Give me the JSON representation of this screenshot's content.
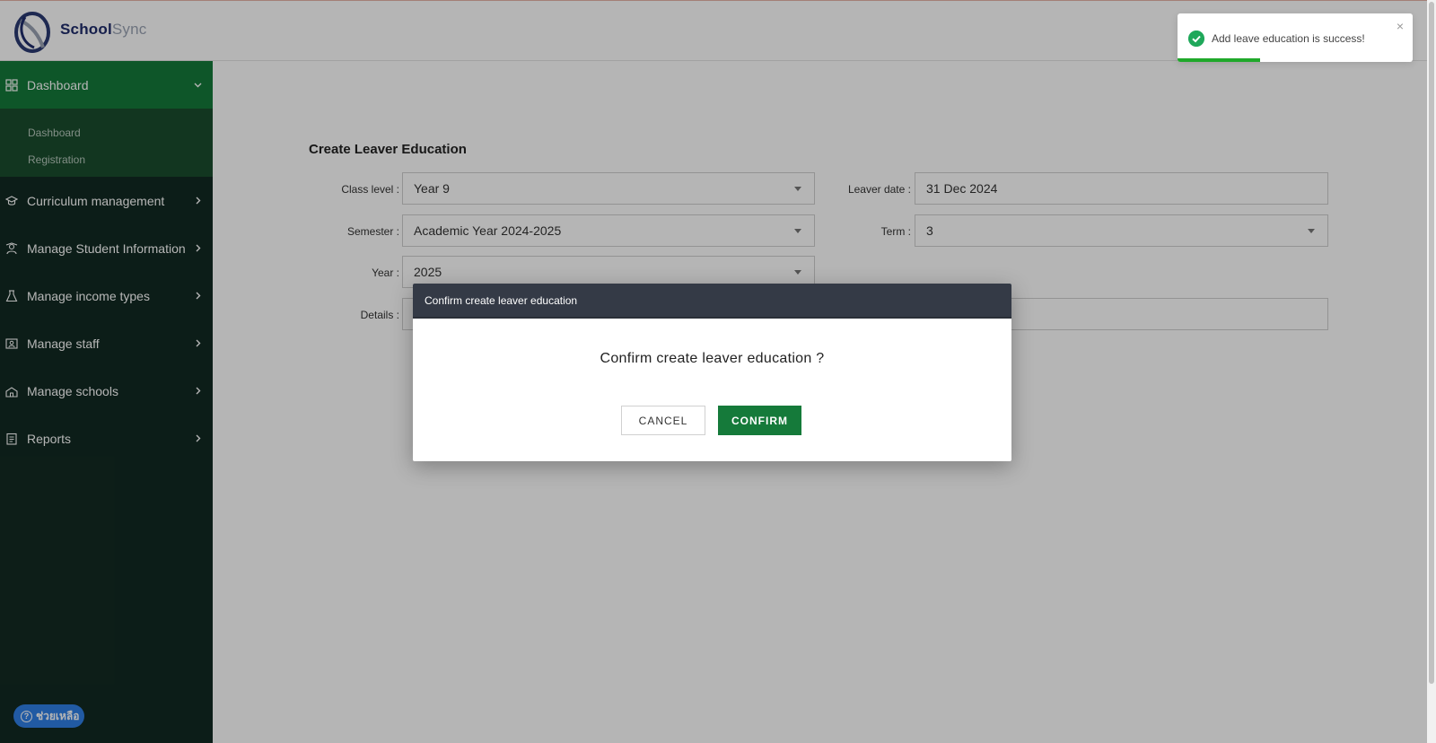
{
  "brand": {
    "part1": "School",
    "part2": "Sync"
  },
  "sidebar": {
    "items": [
      {
        "label": "Dashboard",
        "icon": "grid-icon"
      },
      {
        "label": "Curriculum management",
        "icon": "graduation-cap-icon"
      },
      {
        "label": "Manage Student Information",
        "icon": "student-icon"
      },
      {
        "label": "Manage income types",
        "icon": "flask-icon"
      },
      {
        "label": "Manage staff",
        "icon": "staff-icon"
      },
      {
        "label": "Manage schools",
        "icon": "school-icon"
      },
      {
        "label": "Reports",
        "icon": "report-icon"
      }
    ],
    "submenu": [
      {
        "label": "Dashboard"
      },
      {
        "label": "Registration"
      }
    ]
  },
  "help": {
    "label": "ช่วยเหลือ"
  },
  "form": {
    "title": "Create Leaver Education",
    "class_level": {
      "label": "Class level :",
      "value": "Year 9"
    },
    "leaver_date": {
      "label": "Leaver date :",
      "value": "31 Dec 2024"
    },
    "semester": {
      "label": "Semester :",
      "value": "Academic Year 2024-2025"
    },
    "term": {
      "label": "Term :",
      "value": "3"
    },
    "year": {
      "label": "Year :",
      "value": "2025"
    },
    "details": {
      "label": "Details :",
      "value": ""
    }
  },
  "modal": {
    "title": "Confirm create leaver education",
    "message": "Confirm create leaver education ?",
    "cancel_label": "CANCEL",
    "confirm_label": "CONFIRM"
  },
  "toast": {
    "message": "Add leave education is success!",
    "close": "×",
    "progress": 0.35,
    "color": "#1fa82a"
  },
  "colors": {
    "accent": "#157a3a",
    "sidebar": "#122a22"
  }
}
